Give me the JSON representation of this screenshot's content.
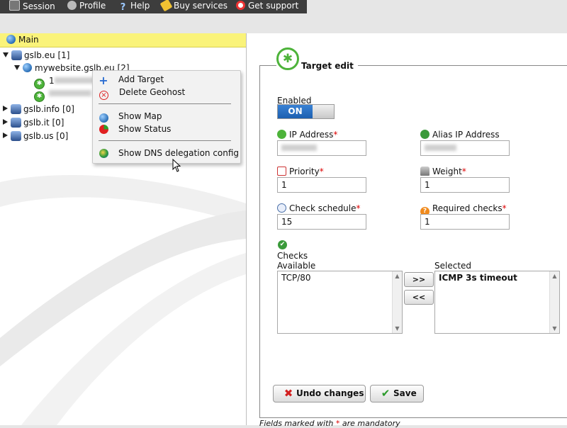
{
  "topbar": {
    "items": [
      {
        "label": "Session",
        "icon": "session-icon"
      },
      {
        "label": "Profile",
        "icon": "profile-icon"
      },
      {
        "label": "Help",
        "icon": "help-icon"
      },
      {
        "label": "Buy services",
        "icon": "buy-icon"
      },
      {
        "label": "Get support",
        "icon": "lifebuoy-icon"
      }
    ]
  },
  "tree": {
    "header": "Main",
    "nodes": [
      {
        "label": "gslb.eu [1]",
        "expanded": true
      },
      {
        "label": "mywebsite.gslb.eu [2]",
        "expanded": true
      },
      {
        "label": "gslb.info [0]",
        "expanded": false
      },
      {
        "label": "gslb.it [0]",
        "expanded": false
      },
      {
        "label": "gslb.us [0]",
        "expanded": false
      }
    ],
    "targets": [
      {
        "label_prefix": "1"
      },
      {
        "label_prefix": ""
      }
    ]
  },
  "context_menu": {
    "items": [
      {
        "label": "Add Target",
        "icon": "plus-icon"
      },
      {
        "label": "Delete Geohost",
        "icon": "delete-icon"
      },
      {
        "label": "Show Map",
        "icon": "globe-icon"
      },
      {
        "label": "Show Status",
        "icon": "status-pie-icon"
      },
      {
        "label": "Show DNS delegation config",
        "icon": "earth-icon"
      }
    ]
  },
  "form": {
    "title": "Target edit",
    "enabled_label": "Enabled",
    "toggle_label": "ON",
    "ip_label": "IP Address",
    "alias_label": "Alias IP Address",
    "priority_label": "Priority",
    "priority_value": "1",
    "weight_label": "Weight",
    "weight_value": "1",
    "schedule_label": "Check schedule",
    "schedule_value": "15",
    "required_label": "Required checks",
    "required_value": "1",
    "required_marker": "*",
    "checks_label": "Checks",
    "available_label": "Available",
    "selected_label": "Selected",
    "available_items": [
      "TCP/80"
    ],
    "selected_items": [
      "ICMP 3s timeout"
    ],
    "add_label": ">>",
    "remove_label": "<<",
    "undo_label": "Undo changes",
    "save_label": "Save",
    "footnote_pre": "Fields marked with ",
    "footnote_post": " are mandatory"
  },
  "colors": {
    "accent": "#1c5fb0",
    "header": "#faf37a",
    "topbar": "#3d3d3d",
    "required": "#dd0000",
    "target_green": "#4db33a"
  }
}
